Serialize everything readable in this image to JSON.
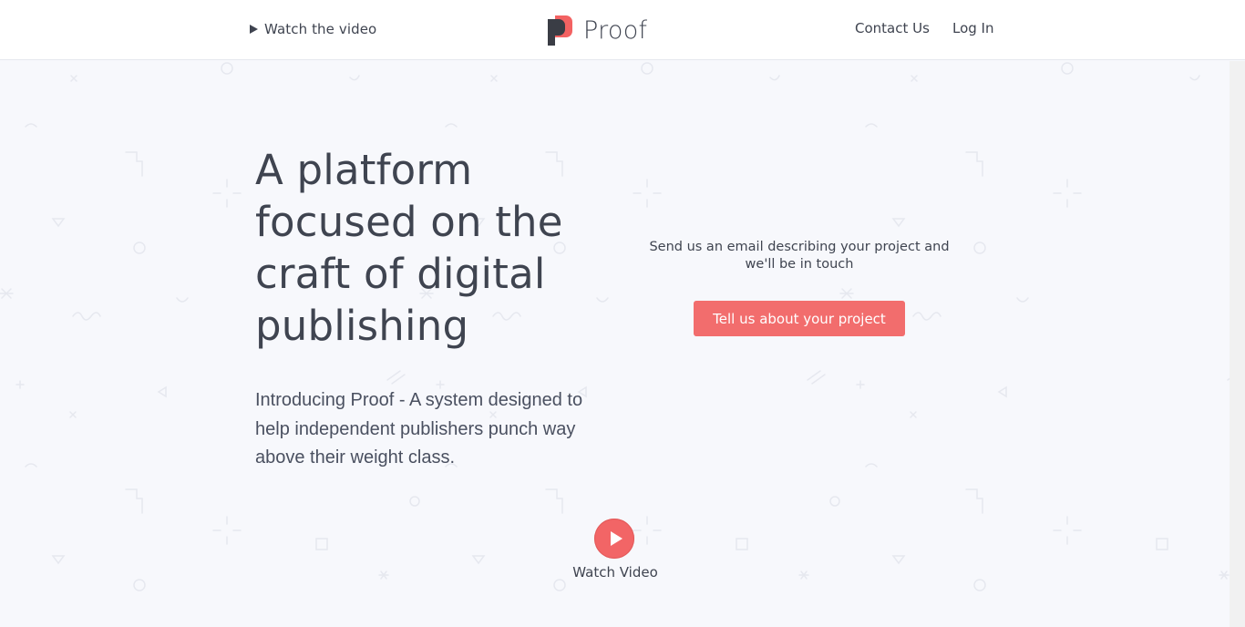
{
  "header": {
    "watch_video_label": "Watch the video",
    "logo_text": "Proof",
    "contact_label": "Contact Us",
    "login_label": "Log In"
  },
  "hero": {
    "title": "A platform focused on the craft of digital publishing",
    "subtitle": "Introducing Proof - A system designed to help independent publishers punch way above their weight class."
  },
  "cta": {
    "text": "Send us an email describing your project and we'll be in touch",
    "button_label": "Tell us about your project"
  },
  "video": {
    "label": "Watch Video"
  },
  "colors": {
    "accent": "#f26d6d",
    "text": "#3f4450",
    "background": "#f7f8fc",
    "logo_red": "#f25a5a",
    "logo_dark": "#3a3d45"
  },
  "icons": [
    "play-icon",
    "proof-logo-icon",
    "play-button-icon"
  ]
}
